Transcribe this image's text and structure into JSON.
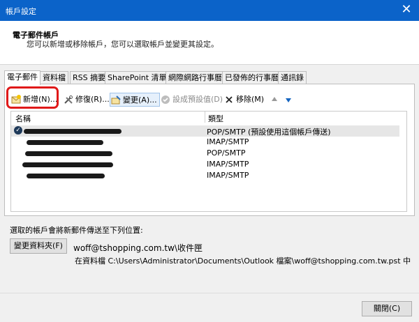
{
  "window": {
    "title": "帳戶設定",
    "close_glyph": "✕"
  },
  "header": {
    "title": "電子郵件帳戶",
    "subtitle": "您可以新增或移除帳戶，您可以選取帳戶並變更其設定。"
  },
  "tabs": [
    "電子郵件",
    "資料檔",
    "RSS 摘要",
    "SharePoint 清單",
    "網際網路行事曆",
    "已發佈的行事曆",
    "通訊錄"
  ],
  "toolbar": {
    "new_label": "新增(N)...",
    "repair_label": "修復(R)...",
    "change_label": "變更(A)...",
    "set_default_label": "設成預設值(D)",
    "remove_label": "移除(M)"
  },
  "list": {
    "columns": {
      "name": "名稱",
      "type": "類型"
    },
    "rows": [
      {
        "type": "POP/SMTP (預設使用這個帳戶傳送)",
        "is_default": true,
        "name_redacted": true
      },
      {
        "type": "IMAP/SMTP",
        "is_default": false,
        "name_redacted": true
      },
      {
        "type": "POP/SMTP",
        "is_default": false,
        "name_redacted": true
      },
      {
        "type": "IMAP/SMTP",
        "is_default": false,
        "name_redacted": true
      },
      {
        "type": "IMAP/SMTP",
        "is_default": false,
        "name_redacted": true
      }
    ]
  },
  "delivery": {
    "label": "選取的帳戶會將新郵件傳送至下列位置:",
    "change_folder_button": "變更資料夾(F)",
    "path": "woff@tshopping.com.tw\\收件匣",
    "file": "在資料檔 C:\\Users\\Administrator\\Documents\\Outlook 檔案\\woff@tshopping.com.tw.pst 中"
  },
  "footer": {
    "close_button": "關閉(C)"
  },
  "colors": {
    "titlebar": "#0b63c9",
    "highlight": "#e01919",
    "up_arrow": "#9a9a9a",
    "down_arrow": "#1565c0"
  }
}
